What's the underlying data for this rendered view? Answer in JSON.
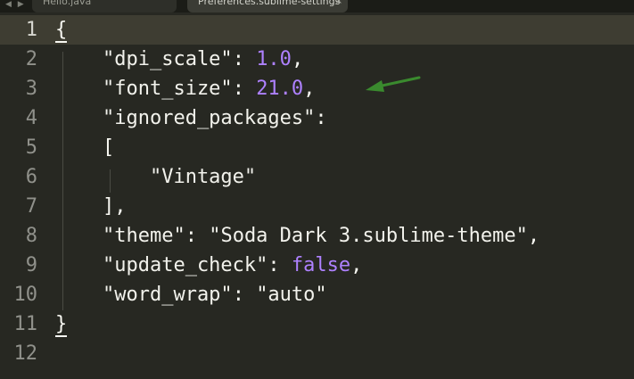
{
  "tabs": {
    "nav_arrows": "◀ ▶",
    "items": [
      {
        "label": "Hello.java",
        "close": ""
      },
      {
        "label": "Preferences.sublime-settings",
        "close": "×"
      }
    ]
  },
  "editor": {
    "line_numbers": [
      "1",
      "2",
      "3",
      "4",
      "5",
      "6",
      "7",
      "8",
      "9",
      "10",
      "11",
      "12"
    ],
    "active_line": 1,
    "lines": [
      {
        "tokens": [
          {
            "t": "{",
            "c": "punct"
          }
        ]
      },
      {
        "tokens": [
          {
            "t": "    \"dpi_scale\"",
            "c": "key"
          },
          {
            "t": ": ",
            "c": "punct"
          },
          {
            "t": "1.0",
            "c": "num"
          },
          {
            "t": ",",
            "c": "punct"
          }
        ]
      },
      {
        "tokens": [
          {
            "t": "    \"font_size\"",
            "c": "key"
          },
          {
            "t": ": ",
            "c": "punct"
          },
          {
            "t": "21.0",
            "c": "num"
          },
          {
            "t": ",",
            "c": "punct"
          }
        ]
      },
      {
        "tokens": [
          {
            "t": "    \"ignored_packages\"",
            "c": "key"
          },
          {
            "t": ":",
            "c": "punct"
          }
        ]
      },
      {
        "tokens": [
          {
            "t": "    [",
            "c": "punct"
          }
        ]
      },
      {
        "tokens": [
          {
            "t": "        \"Vintage\"",
            "c": "key"
          }
        ]
      },
      {
        "tokens": [
          {
            "t": "    ],",
            "c": "punct"
          }
        ]
      },
      {
        "tokens": [
          {
            "t": "    \"theme\"",
            "c": "key"
          },
          {
            "t": ": ",
            "c": "punct"
          },
          {
            "t": "\"Soda Dark 3.sublime-theme\"",
            "c": "key"
          },
          {
            "t": ",",
            "c": "punct"
          }
        ]
      },
      {
        "tokens": [
          {
            "t": "    \"update_check\"",
            "c": "key"
          },
          {
            "t": ": ",
            "c": "punct"
          },
          {
            "t": "false",
            "c": "bool"
          },
          {
            "t": ",",
            "c": "punct"
          }
        ]
      },
      {
        "tokens": [
          {
            "t": "    \"word_wrap\"",
            "c": "key"
          },
          {
            "t": ": ",
            "c": "punct"
          },
          {
            "t": "\"auto\"",
            "c": "key"
          }
        ]
      },
      {
        "tokens": [
          {
            "t": "}",
            "c": "punct"
          }
        ]
      },
      {
        "tokens": []
      }
    ]
  },
  "annotation": {
    "icon": "green-arrow-icon",
    "color": "#3a8a2e"
  },
  "colors": {
    "background": "#272822",
    "current_line": "#3e3d32",
    "number": "#ae81ff",
    "text": "#f8f8f2"
  }
}
